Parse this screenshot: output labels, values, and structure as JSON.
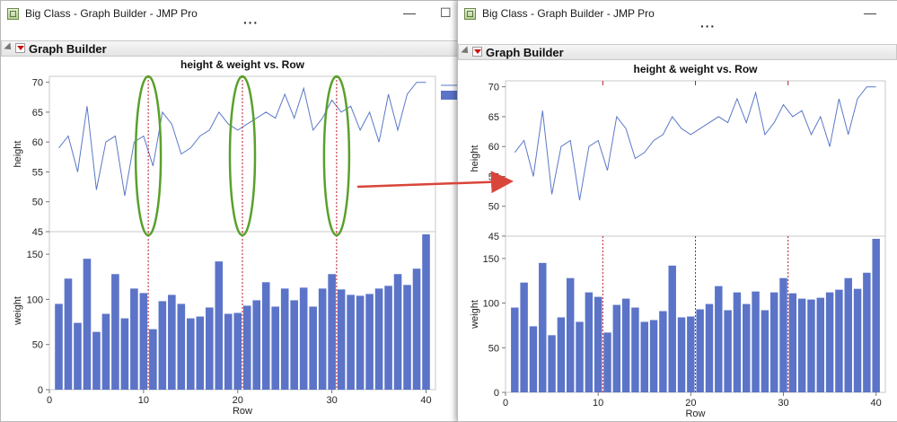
{
  "left_window": {
    "title": "Big Class - Graph Builder - JMP Pro",
    "caption_minimize": "—",
    "caption_maximize": "☐",
    "toolbar_dots": "···",
    "section_title": "Graph Builder"
  },
  "right_window": {
    "title": "Big Class - Graph Builder - JMP Pro",
    "caption_minimize": "—",
    "toolbar_dots": "···",
    "section_title": "Graph Builder"
  },
  "colors": {
    "line": "#5b78c8",
    "bar": "#5b74c8",
    "ref_line": "#c0192b",
    "ellipse": "#5aa02c",
    "arrow": "#d9453a"
  },
  "chart_data": [
    {
      "type": "line+bar",
      "title": "height & weight vs. Row",
      "xlabel": "Row",
      "x": [
        1,
        2,
        3,
        4,
        5,
        6,
        7,
        8,
        9,
        10,
        11,
        12,
        13,
        14,
        15,
        16,
        17,
        18,
        19,
        20,
        21,
        22,
        23,
        24,
        25,
        26,
        27,
        28,
        29,
        30,
        31,
        32,
        33,
        34,
        35,
        36,
        37,
        38,
        39,
        40
      ],
      "xlim": [
        0,
        41
      ],
      "xticks": [
        0,
        10,
        20,
        30,
        40
      ],
      "top": {
        "ylabel": "height",
        "ylim": [
          45,
          71
        ],
        "yticks": [
          45,
          50,
          55,
          60,
          65,
          70
        ],
        "values": [
          59,
          61,
          55,
          66,
          52,
          60,
          61,
          51,
          60,
          61,
          56,
          65,
          63,
          58,
          59,
          61,
          62,
          65,
          63,
          62,
          63,
          64,
          65,
          64,
          68,
          64,
          69,
          62,
          64,
          67,
          65,
          66,
          62,
          65,
          60,
          68,
          62,
          68,
          70,
          70
        ]
      },
      "bottom": {
        "ylabel": "weight",
        "ylim": [
          0,
          175
        ],
        "yticks": [
          0,
          50,
          100,
          150
        ],
        "values": [
          95,
          123,
          74,
          145,
          64,
          84,
          128,
          79,
          112,
          107,
          67,
          98,
          105,
          95,
          79,
          81,
          91,
          142,
          84,
          85,
          93,
          99,
          119,
          92,
          112,
          99,
          113,
          92,
          112,
          128,
          111,
          105,
          104,
          106,
          112,
          115,
          128,
          116,
          134,
          172
        ]
      },
      "reference_lines_x": [
        10.5,
        20.5,
        30.5
      ],
      "annotations": [
        "ellipses around reference lines in height panel"
      ]
    },
    {
      "type": "line+bar",
      "title": "height & weight vs. Row",
      "xlabel": "Row",
      "x": [
        1,
        2,
        3,
        4,
        5,
        6,
        7,
        8,
        9,
        10,
        11,
        12,
        13,
        14,
        15,
        16,
        17,
        18,
        19,
        20,
        21,
        22,
        23,
        24,
        25,
        26,
        27,
        28,
        29,
        30,
        31,
        32,
        33,
        34,
        35,
        36,
        37,
        38,
        39,
        40
      ],
      "xlim": [
        0,
        41
      ],
      "xticks": [
        0,
        10,
        20,
        30,
        40
      ],
      "top": {
        "ylabel": "height",
        "ylim": [
          45,
          71
        ],
        "yticks": [
          45,
          50,
          55,
          60,
          65,
          70
        ],
        "values": [
          59,
          61,
          55,
          66,
          52,
          60,
          61,
          51,
          60,
          61,
          56,
          65,
          63,
          58,
          59,
          61,
          62,
          65,
          63,
          62,
          63,
          64,
          65,
          64,
          68,
          64,
          69,
          62,
          64,
          67,
          65,
          66,
          62,
          65,
          60,
          68,
          62,
          68,
          70,
          70
        ]
      },
      "bottom": {
        "ylabel": "weight",
        "ylim": [
          0,
          175
        ],
        "yticks": [
          0,
          50,
          100,
          150
        ],
        "values": [
          95,
          123,
          74,
          145,
          64,
          84,
          128,
          79,
          112,
          107,
          67,
          98,
          105,
          95,
          79,
          81,
          91,
          142,
          84,
          85,
          93,
          99,
          119,
          92,
          112,
          99,
          113,
          92,
          112,
          128,
          111,
          105,
          104,
          106,
          112,
          115,
          128,
          116,
          134,
          172
        ]
      },
      "reference_lines_x": [
        10.5,
        20.5,
        30.5
      ]
    }
  ]
}
